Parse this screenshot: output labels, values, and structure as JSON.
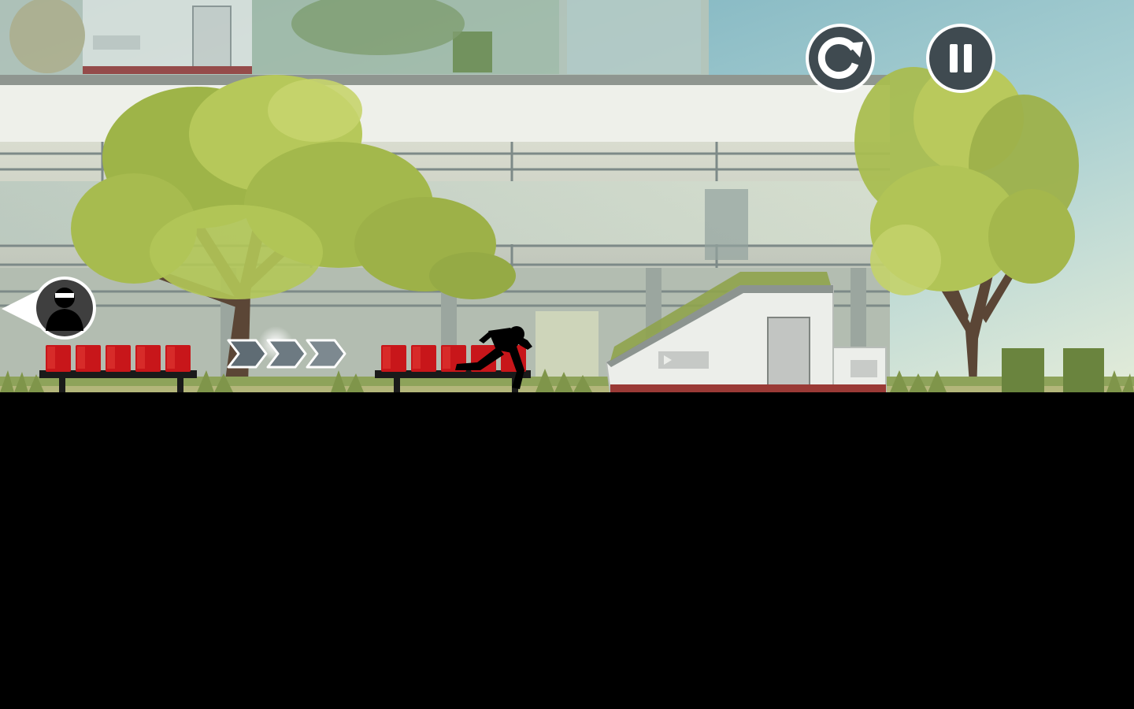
{
  "game": {
    "colors": {
      "sky_top": "#5f9fb0",
      "sky_bottom": "#c7dfd8",
      "building": "#c9cfc0",
      "building_dark": "#7f8a86",
      "roof_band": "#f0f1ec",
      "foliage": "#9cb547",
      "foliage_light": "#c4d367",
      "trunk": "#5b4636",
      "seat_red": "#c8161a",
      "ground": "#000000",
      "hud_fill": "#ffffff",
      "hud_ring": "#4f5b62"
    },
    "hud": {
      "restart_icon": "restart-icon",
      "pause_icon": "pause-icon"
    },
    "chaser_indicator_icon": "hunter-silhouette-icon",
    "boost_arrows_count": 3,
    "player_state": "running"
  }
}
